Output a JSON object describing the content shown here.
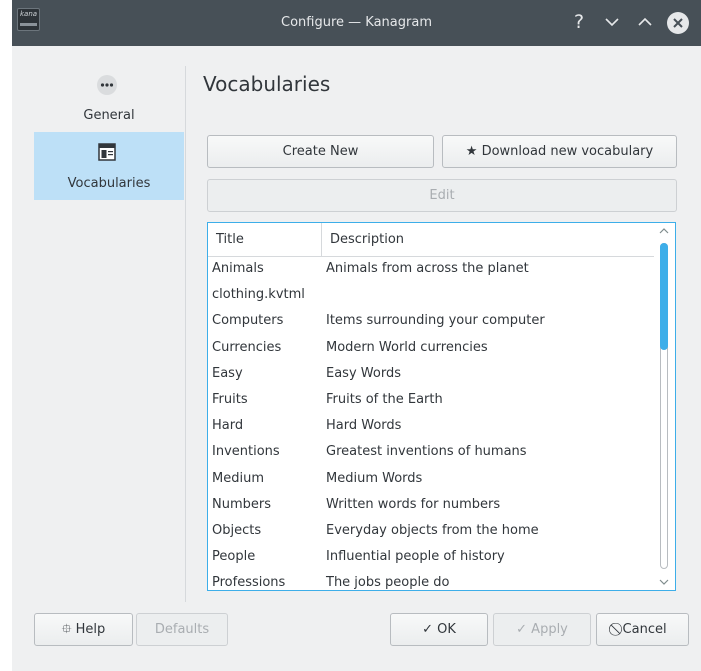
{
  "window": {
    "title": "Configure — Kanagram",
    "app_icon_text": "kana"
  },
  "titlebar_buttons": {
    "help": "?",
    "minimize": "⌄",
    "maximize": "⌃",
    "close": "✕"
  },
  "sidebar": {
    "items": [
      {
        "label": "General",
        "icon": "more-dots-icon",
        "selected": false
      },
      {
        "label": "Vocabularies",
        "icon": "vocabulary-list-icon",
        "selected": true
      }
    ]
  },
  "page": {
    "heading": "Vocabularies"
  },
  "buttons": {
    "create_new": "Create New",
    "download_icon": "★",
    "download": "Download new vocabulary",
    "edit": "Edit",
    "help_icon": "⯐",
    "help": "Help",
    "defaults": "Defaults",
    "ok_icon": "✓",
    "ok": "OK",
    "apply_icon": "✓",
    "apply": "Apply",
    "cancel_icon": "⃠",
    "cancel": "Cancel"
  },
  "table": {
    "columns": [
      "Title",
      "Description"
    ],
    "rows": [
      [
        "Animals",
        "Animals from across the planet"
      ],
      [
        "clothing.kvtml",
        ""
      ],
      [
        "Computers",
        "Items surrounding your computer"
      ],
      [
        "Currencies",
        "Modern World currencies"
      ],
      [
        "Easy",
        "Easy Words"
      ],
      [
        "Fruits",
        "Fruits of the Earth"
      ],
      [
        "Hard",
        "Hard Words"
      ],
      [
        "Inventions",
        "Greatest inventions of humans"
      ],
      [
        "Medium",
        "Medium Words"
      ],
      [
        "Numbers",
        "Written words for numbers"
      ],
      [
        "Objects",
        "Everyday objects from the home"
      ],
      [
        "People",
        "Influential people of history"
      ],
      [
        "Professions",
        "The jobs people do"
      ]
    ]
  },
  "colors": {
    "accent": "#3daee9",
    "selection": "#bde0f7",
    "titlebar": "#475057",
    "dialog_bg": "#eff0f1"
  }
}
